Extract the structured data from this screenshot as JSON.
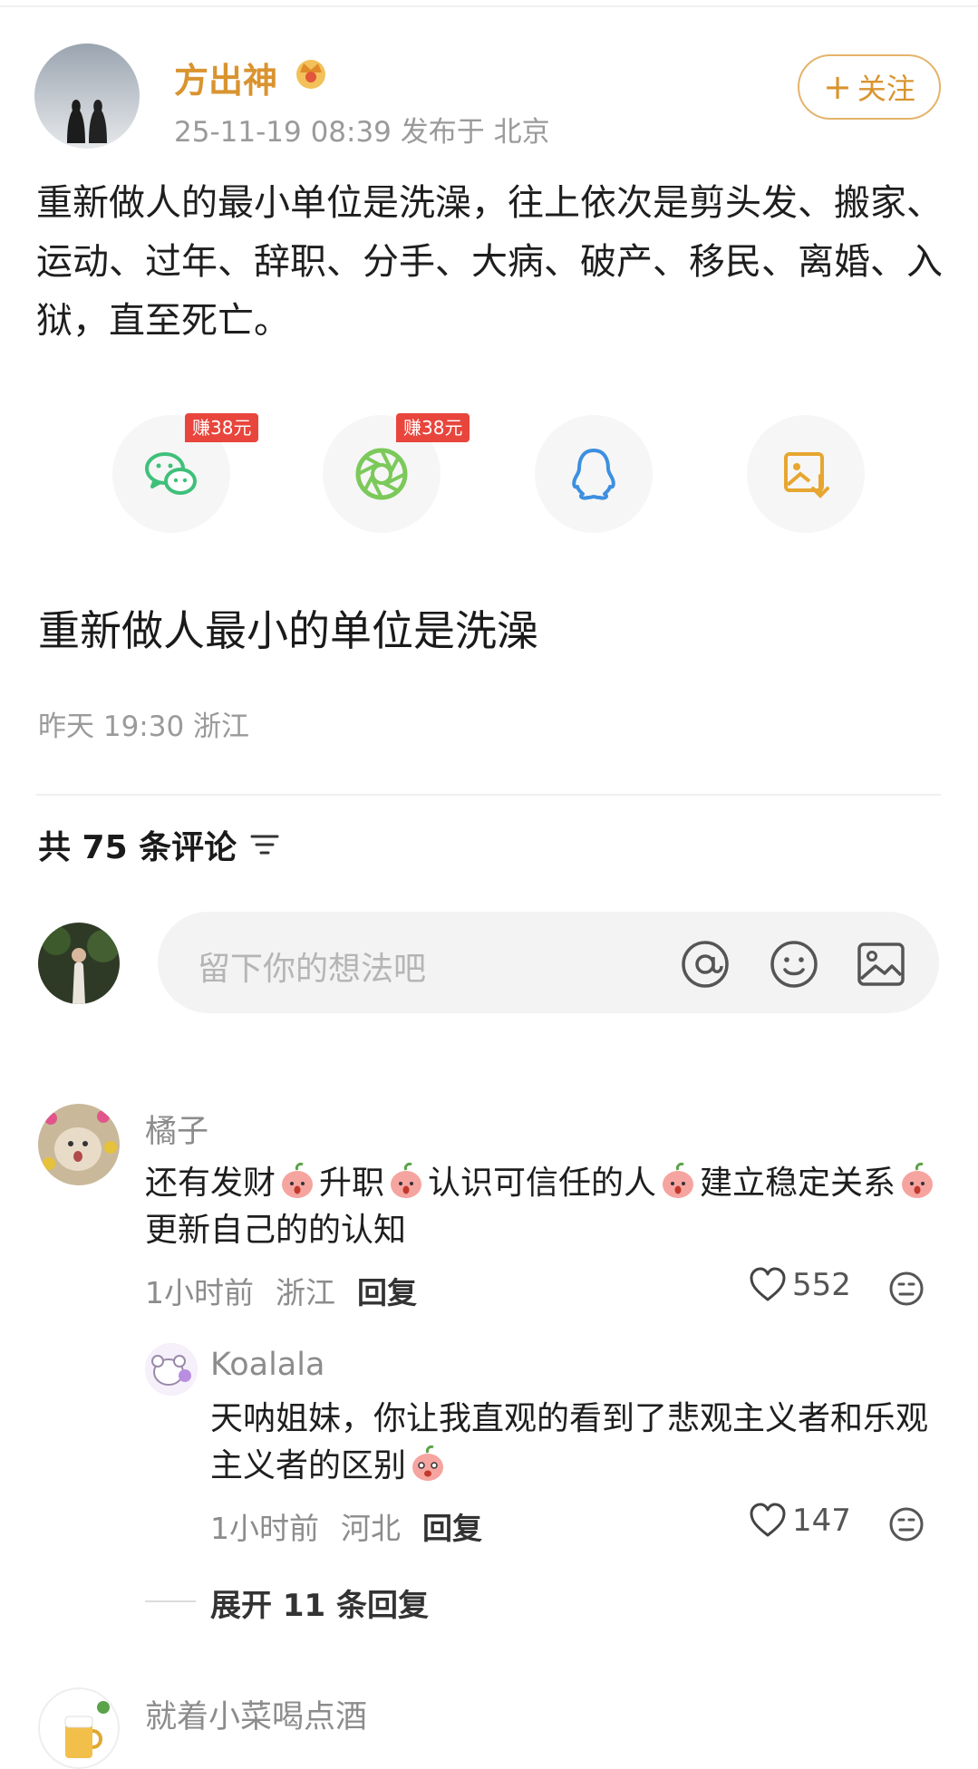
{
  "post": {
    "author": "方出神",
    "meta": "25-11-19 08:39  发布于 北京",
    "follow_label": "关注",
    "follow_plus": "+",
    "body": "重新做人的最小单位是洗澡，往上依次是剪头发、搬家、运动、过年、辞职、分手、大病、破产、移民、离婚、入狱，直至死亡。",
    "title": "重新做人最小的单位是洗澡",
    "time": "昨天 19:30 浙江"
  },
  "share": {
    "badge1": "赚38元",
    "badge2": "赚38元",
    "items": [
      "wechat-icon",
      "moments-icon",
      "qq-icon",
      "save-image-icon"
    ],
    "colors": {
      "wechat": "#3fc07a",
      "moments": "#7bc95a",
      "qq": "#3d8fe0",
      "save": "#e6a630"
    }
  },
  "comments_header": {
    "count_label": "共 75 条评论"
  },
  "input": {
    "placeholder": "留下你的想法吧"
  },
  "comments": [
    {
      "name": "橘子",
      "text_parts": [
        "还有发财",
        "升职",
        "认识可信任的人",
        "建立稳定关系",
        "更新自己的的认知"
      ],
      "time": "1小时前",
      "location": "浙江",
      "reply_label": "回复",
      "likes": "552"
    },
    {
      "name": "Koalala",
      "text": "天呐姐妹，你让我直观的看到了悲观主义者和乐观主义者的区别",
      "time": "1小时前",
      "location": "河北",
      "reply_label": "回复",
      "likes": "147"
    },
    {
      "name": "就着小菜喝点酒"
    }
  ],
  "expand_label": "展开 11 条回复",
  "colors": {
    "accent": "#d99430",
    "muted": "#8c8c8c",
    "badge": "#e8453c"
  }
}
